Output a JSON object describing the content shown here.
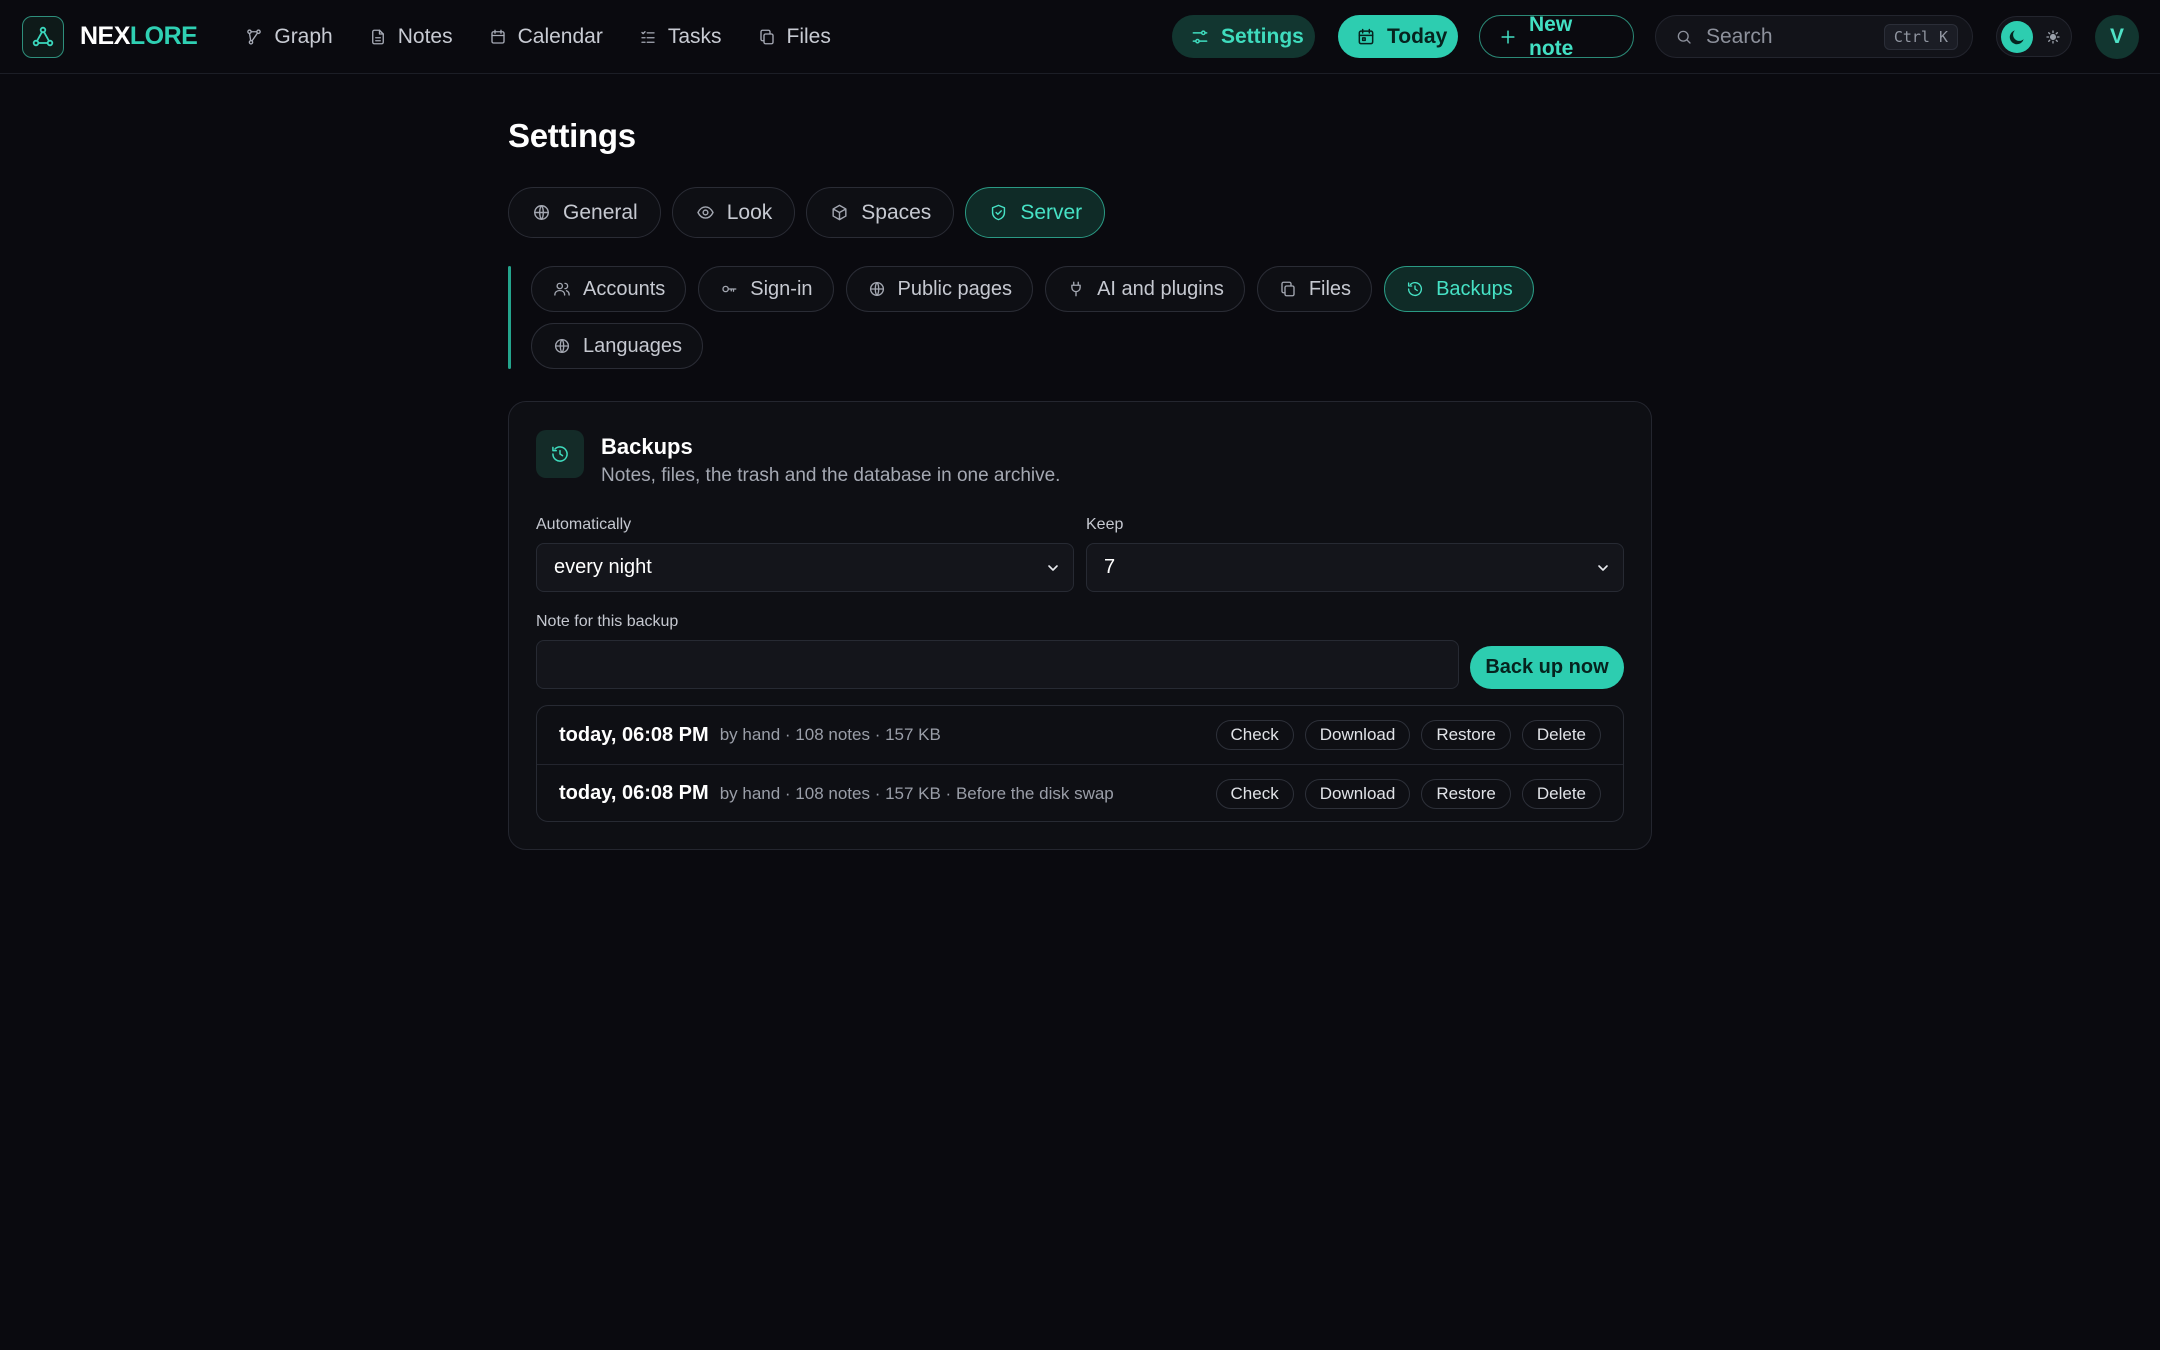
{
  "brand": {
    "name_part1": "NEX",
    "name_part2": "LORE"
  },
  "nav": [
    {
      "label": "Graph",
      "icon": "graph-icon"
    },
    {
      "label": "Notes",
      "icon": "document-icon"
    },
    {
      "label": "Calendar",
      "icon": "calendar-icon"
    },
    {
      "label": "Tasks",
      "icon": "list-icon"
    },
    {
      "label": "Files",
      "icon": "files-icon"
    }
  ],
  "header": {
    "settings_label": "Settings",
    "today_label": "Today",
    "new_note_label": "New note",
    "search_placeholder": "Search",
    "search_shortcut": "Ctrl K",
    "avatar_initial": "V"
  },
  "page": {
    "title": "Settings"
  },
  "tabs": [
    {
      "label": "General",
      "icon": "globe-icon",
      "active": false
    },
    {
      "label": "Look",
      "icon": "eye-icon",
      "active": false
    },
    {
      "label": "Spaces",
      "icon": "box-icon",
      "active": false
    },
    {
      "label": "Server",
      "icon": "shield-icon",
      "active": true
    }
  ],
  "subtabs": [
    {
      "label": "Accounts",
      "icon": "users-icon",
      "active": false
    },
    {
      "label": "Sign-in",
      "icon": "key-icon",
      "active": false
    },
    {
      "label": "Public pages",
      "icon": "globe-icon",
      "active": false
    },
    {
      "label": "AI and plugins",
      "icon": "plug-icon",
      "active": false
    },
    {
      "label": "Files",
      "icon": "files-icon",
      "active": false
    },
    {
      "label": "Backups",
      "icon": "history-icon",
      "active": true
    },
    {
      "label": "Languages",
      "icon": "globe-icon",
      "active": false
    }
  ],
  "backups": {
    "title": "Backups",
    "subtitle": "Notes, files, the trash and the database in one archive.",
    "auto_label": "Automatically",
    "auto_value": "every night",
    "keep_label": "Keep",
    "keep_value": "7",
    "note_label": "Note for this backup",
    "note_value": "",
    "backup_button": "Back up now",
    "items": [
      {
        "time": "today, 06:08 PM",
        "meta": "by hand · 108 notes · 157 KB"
      },
      {
        "time": "today, 06:08 PM",
        "meta": "by hand · 108 notes · 157 KB · Before the disk swap"
      }
    ],
    "actions": {
      "check": "Check",
      "download": "Download",
      "restore": "Restore",
      "delete": "Delete"
    }
  },
  "colors": {
    "accent": "#2dcdb0",
    "background": "#0a0a0f",
    "card": "#0e0f14",
    "accent_dark": "#123630"
  }
}
